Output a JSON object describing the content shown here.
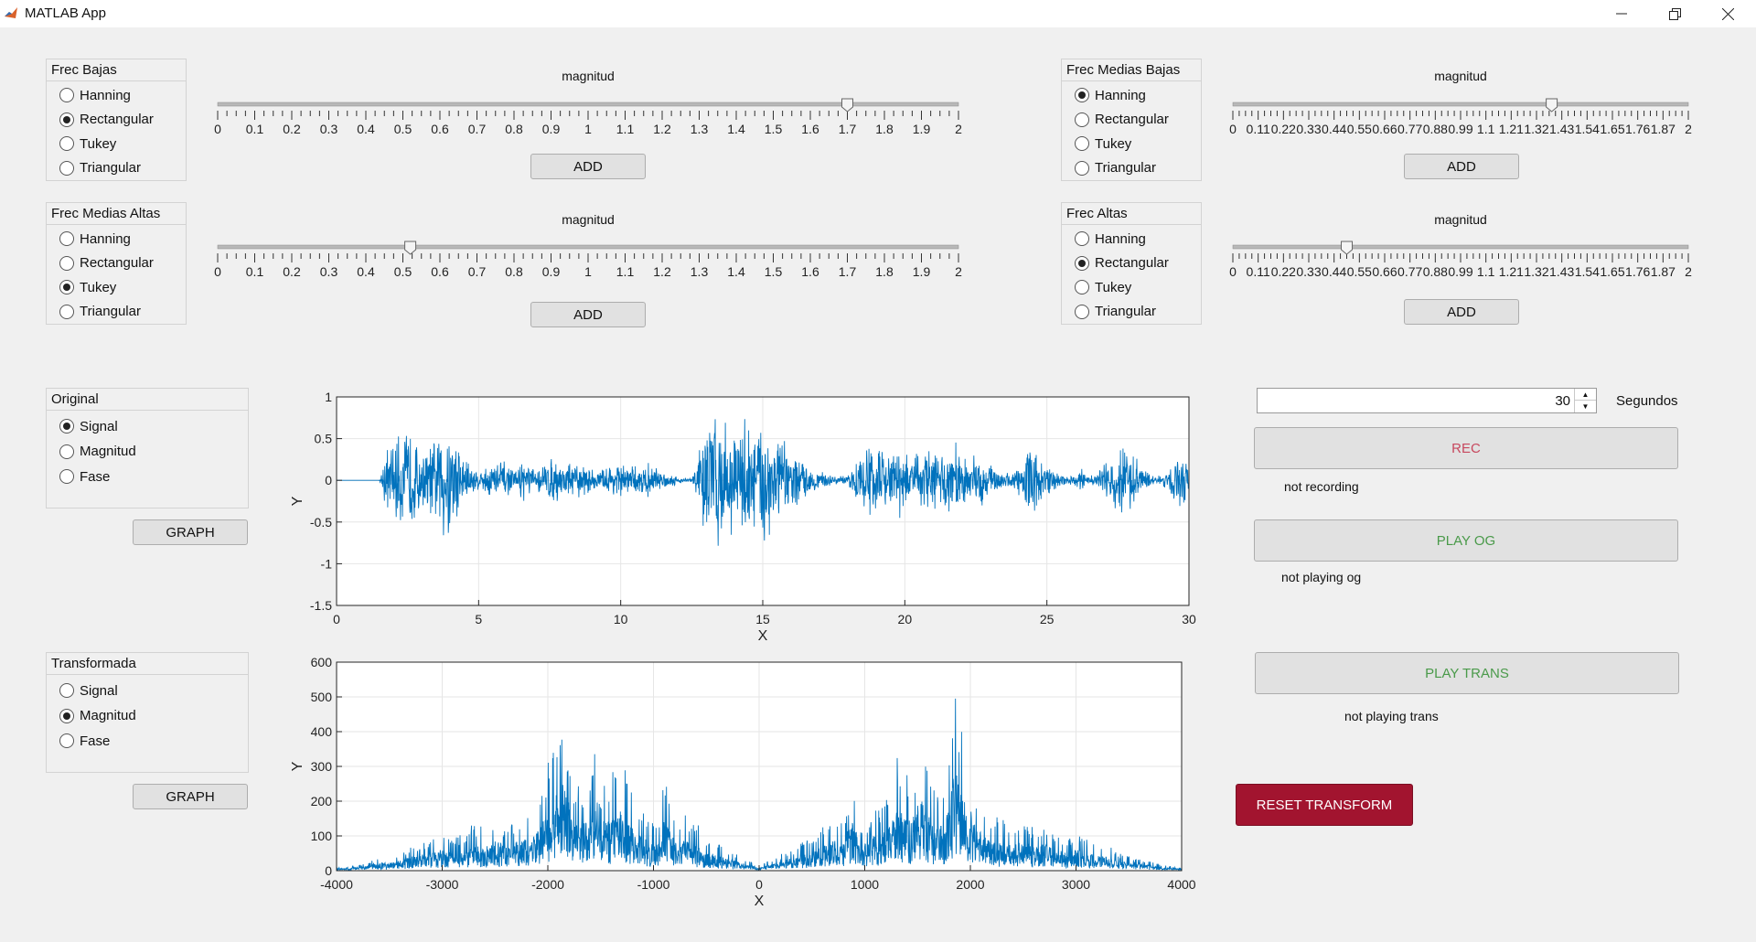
{
  "window": {
    "title": "MATLAB App"
  },
  "band_panels": [
    {
      "id": "bajas",
      "title": "Frec Bajas",
      "options": [
        "Hanning",
        "Rectangular",
        "Tukey",
        "Triangular"
      ],
      "selected": 1,
      "slider": {
        "label": "magnitud",
        "min": 0,
        "max": 2,
        "value": 1.7,
        "ticks": [
          "0",
          "0.1",
          "0.2",
          "0.3",
          "0.4",
          "0.5",
          "0.6",
          "0.7",
          "0.8",
          "0.9",
          "1",
          "1.1",
          "1.2",
          "1.3",
          "1.4",
          "1.5",
          "1.6",
          "1.7",
          "1.8",
          "1.9",
          "2"
        ]
      },
      "button": "ADD"
    },
    {
      "id": "medias_altas",
      "title": "Frec Medias Altas",
      "options": [
        "Hanning",
        "Rectangular",
        "Tukey",
        "Triangular"
      ],
      "selected": 2,
      "slider": {
        "label": "magnitud",
        "min": 0,
        "max": 2,
        "value": 0.52,
        "ticks": [
          "0",
          "0.1",
          "0.2",
          "0.3",
          "0.4",
          "0.5",
          "0.6",
          "0.7",
          "0.8",
          "0.9",
          "1",
          "1.1",
          "1.2",
          "1.3",
          "1.4",
          "1.5",
          "1.6",
          "1.7",
          "1.8",
          "1.9",
          "2"
        ]
      },
      "button": "ADD"
    },
    {
      "id": "medias_bajas",
      "title": "Frec Medias Bajas",
      "options": [
        "Hanning",
        "Rectangular",
        "Tukey",
        "Triangular"
      ],
      "selected": 0,
      "slider": {
        "label": "magnitud",
        "min": 0,
        "max": 2,
        "value": 1.4,
        "ticks": [
          "0",
          "0.11",
          "0.22",
          "0.33",
          "0.44",
          "0.55",
          "0.66",
          "0.77",
          "0.88",
          "0.99",
          "1.1",
          "1.21",
          "1.32",
          "1.43",
          "1.54",
          "1.65",
          "1.76",
          "1.87",
          "2"
        ]
      },
      "button": "ADD"
    },
    {
      "id": "altas",
      "title": "Frec Altas",
      "options": [
        "Hanning",
        "Rectangular",
        "Tukey",
        "Triangular"
      ],
      "selected": 1,
      "slider": {
        "label": "magnitud",
        "min": 0,
        "max": 2,
        "value": 0.5,
        "ticks": [
          "0",
          "0.11",
          "0.22",
          "0.33",
          "0.44",
          "0.55",
          "0.66",
          "0.77",
          "0.88",
          "0.99",
          "1.1",
          "1.21",
          "1.32",
          "1.43",
          "1.54",
          "1.65",
          "1.76",
          "1.87",
          "2"
        ]
      },
      "button": "ADD"
    }
  ],
  "original_panel": {
    "title": "Original",
    "options": [
      "Signal",
      "Magnitud",
      "Fase"
    ],
    "selected": 0,
    "button": "GRAPH"
  },
  "transform_panel": {
    "title": "Transformada",
    "options": [
      "Signal",
      "Magnitud",
      "Fase"
    ],
    "selected": 1,
    "button": "GRAPH"
  },
  "controls": {
    "duration_value": "30",
    "duration_unit": "Segundos",
    "rec_label": "REC",
    "rec_status": "not recording",
    "play_og_label": "PLAY OG",
    "play_og_status": "not playing og",
    "play_trans_label": "PLAY TRANS",
    "play_trans_status": "not playing trans",
    "reset_label": "RESET TRANSFORM"
  },
  "colors": {
    "line": "#0072bd",
    "rec_text": "#c7485e",
    "play_text": "#4a9a4a",
    "reset_bg": "#a2142f"
  },
  "chart_data": [
    {
      "type": "line",
      "title": "",
      "xlabel": "X",
      "ylabel": "Y",
      "xlim": [
        0,
        30
      ],
      "ylim": [
        -1.5,
        1
      ],
      "xticks": [
        0,
        5,
        10,
        15,
        20,
        25,
        30
      ],
      "yticks": [
        -1.5,
        -1,
        -0.5,
        0,
        0.5,
        1
      ],
      "grid": true,
      "series": [
        {
          "envelope_x": [
            0,
            1.5,
            1.7,
            2.2,
            2.6,
            3.0,
            3.5,
            3.9,
            4.3,
            4.6,
            5.0,
            5.5,
            5.8,
            6.2,
            6.6,
            7.0,
            7.5,
            8.0,
            8.6,
            9.2,
            9.8,
            10.4,
            11.0,
            11.5,
            12.0,
            12.5,
            13.0,
            13.3,
            13.6,
            14.0,
            14.4,
            14.8,
            15.2,
            15.6,
            16.0,
            16.4,
            17.0,
            17.5,
            18.0,
            18.5,
            19.0,
            19.4,
            19.8,
            20.3,
            20.8,
            21.3,
            21.8,
            22.3,
            22.8,
            23.3,
            23.8,
            24.1,
            24.4,
            24.8,
            25.3,
            25.8,
            26.2,
            26.5,
            26.8,
            27.2,
            27.6,
            28.0,
            28.4,
            28.8,
            29.2,
            29.6,
            30
          ],
          "envelope_y": [
            0,
            0,
            0.38,
            0.6,
            0.7,
            0.35,
            0.55,
            0.95,
            0.5,
            0.3,
            0.12,
            0.25,
            0.3,
            0.12,
            0.28,
            0.12,
            0.3,
            0.25,
            0.22,
            0.12,
            0.25,
            0.18,
            0.22,
            0.12,
            0.05,
            0.03,
            0.8,
            0.95,
            0.85,
            0.6,
            0.9,
            0.7,
            0.95,
            0.6,
            0.4,
            0.25,
            0.12,
            0.05,
            0.06,
            0.4,
            0.55,
            0.3,
            0.5,
            0.3,
            0.5,
            0.35,
            0.5,
            0.3,
            0.35,
            0.12,
            0.1,
            0.25,
            0.45,
            0.3,
            0.12,
            0.05,
            0.15,
            0.05,
            0.12,
            0.3,
            0.5,
            0.35,
            0.15,
            0.05,
            0.1,
            0.45,
            0.2
          ]
        }
      ]
    },
    {
      "type": "line",
      "title": "",
      "xlabel": "X",
      "ylabel": "Y",
      "xlim": [
        -4000,
        4000
      ],
      "ylim": [
        0,
        600
      ],
      "xticks": [
        -4000,
        -3000,
        -2000,
        -1000,
        0,
        1000,
        2000,
        3000,
        4000
      ],
      "yticks": [
        0,
        100,
        200,
        300,
        400,
        500,
        600
      ],
      "grid": true,
      "series": [
        {
          "envelope_x": [
            0,
            50,
            100,
            150,
            200,
            300,
            400,
            500,
            600,
            650,
            700,
            750,
            800,
            850,
            900,
            950,
            1000,
            1050,
            1100,
            1150,
            1200,
            1250,
            1300,
            1350,
            1400,
            1450,
            1500,
            1550,
            1600,
            1650,
            1700,
            1750,
            1800,
            1850,
            1900,
            1950,
            2000,
            2050,
            2100,
            2200,
            2300,
            2400,
            2500,
            2600,
            2700,
            2800,
            2900,
            3000,
            3100,
            3200,
            3300,
            3400,
            3500,
            3600,
            3700,
            3800,
            3900,
            4000
          ],
          "envelope_y": [
            5,
            20,
            30,
            35,
            45,
            60,
            80,
            90,
            140,
            120,
            170,
            130,
            150,
            230,
            260,
            130,
            150,
            140,
            200,
            170,
            240,
            260,
            350,
            300,
            280,
            260,
            340,
            390,
            300,
            250,
            240,
            250,
            340,
            540,
            440,
            360,
            320,
            250,
            200,
            160,
            150,
            130,
            160,
            120,
            140,
            110,
            90,
            110,
            90,
            80,
            70,
            50,
            40,
            35,
            25,
            15,
            10,
            8
          ]
        }
      ]
    }
  ]
}
